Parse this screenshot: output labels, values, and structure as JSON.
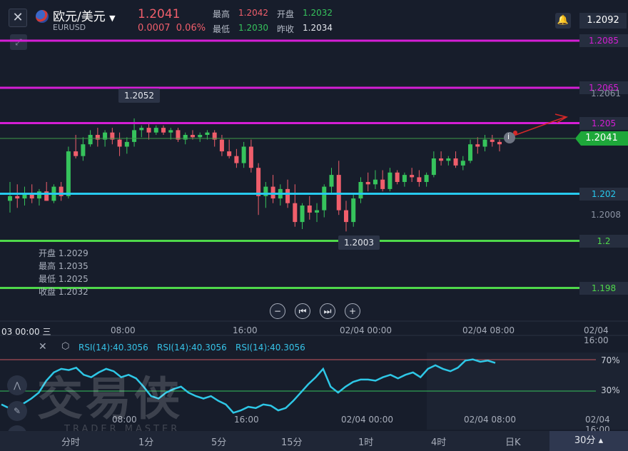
{
  "header": {
    "symbol_name": "欧元/美元",
    "symbol_code": "EURUSD",
    "price": "1.2041",
    "change": "0.0007",
    "change_pct": "0.06%",
    "high_label": "最高",
    "high_value": "1.2042",
    "open_label": "开盘",
    "open_value": "1.2032",
    "low_label": "最低",
    "low_value": "1.2030",
    "prev_close_label": "昨收",
    "prev_close_value": "1.2034",
    "top_right_price": "1.2092"
  },
  "price_lines": [
    {
      "label": "1.2085",
      "color": "#d51ed5"
    },
    {
      "label": "1.2065",
      "color": "#d51ed5"
    },
    {
      "label": "1.205",
      "color": "#d51ed5"
    },
    {
      "label": "1.202",
      "color": "#27c9ee"
    },
    {
      "label": "1.2",
      "color": "#4fd84a"
    },
    {
      "label": "1.198",
      "color": "#4fd84a"
    }
  ],
  "axis_prices": {
    "p1": "1.2061",
    "p2": "1.2008",
    "current": "1.2041"
  },
  "callouts": {
    "high": "1.2052",
    "low": "1.2003"
  },
  "ohlc_panel": {
    "open": "开盘 1.2029",
    "high": "最高 1.2035",
    "low": "最低 1.2025",
    "close": "收盘 1.2032"
  },
  "nav": [
    "−",
    "⏮",
    "⏭",
    "+"
  ],
  "time_axis": {
    "start": "03 00:00 三",
    "labels": [
      "08:00",
      "16:00",
      "02/04 00:00",
      "02/04 08:00",
      "02/04 16:00"
    ]
  },
  "rsi": {
    "labels": [
      "RSI(14):40.3056",
      "RSI(14):40.3056",
      "RSI(14):40.3056"
    ],
    "level_high": "70%",
    "level_low": "30%"
  },
  "rsi_time_axis": [
    "08:00",
    "16:00",
    "02/04 00:00",
    "02/04 08:00",
    "02/04 16:00"
  ],
  "periods": [
    "分时",
    "1分",
    "5分",
    "15分",
    "1时",
    "4时",
    "日K",
    "30分 ▴"
  ],
  "watermark": {
    "main": "交易侠",
    "sub": "TRADER MASTER"
  },
  "chart_data": {
    "type": "candlestick",
    "series": [
      {
        "name": "EURUSD 30分",
        "candles": [
          {
            "o": 1.2017,
            "h": 1.2025,
            "l": 1.2012,
            "c": 1.2019
          },
          {
            "o": 1.2019,
            "h": 1.2024,
            "l": 1.2014,
            "c": 1.2018
          },
          {
            "o": 1.2018,
            "h": 1.2023,
            "l": 1.2015,
            "c": 1.202
          },
          {
            "o": 1.202,
            "h": 1.2024,
            "l": 1.2016,
            "c": 1.2018
          },
          {
            "o": 1.2018,
            "h": 1.2022,
            "l": 1.2015,
            "c": 1.2021
          },
          {
            "o": 1.2021,
            "h": 1.2025,
            "l": 1.2017,
            "c": 1.2017
          },
          {
            "o": 1.2017,
            "h": 1.2024,
            "l": 1.2016,
            "c": 1.2023
          },
          {
            "o": 1.2023,
            "h": 1.2025,
            "l": 1.2017,
            "c": 1.2019
          },
          {
            "o": 1.2019,
            "h": 1.204,
            "l": 1.2018,
            "c": 1.2038
          },
          {
            "o": 1.2038,
            "h": 1.2045,
            "l": 1.2035,
            "c": 1.2036
          },
          {
            "o": 1.2036,
            "h": 1.2044,
            "l": 1.2034,
            "c": 1.2041
          },
          {
            "o": 1.2041,
            "h": 1.2047,
            "l": 1.204,
            "c": 1.2045
          },
          {
            "o": 1.2045,
            "h": 1.2048,
            "l": 1.204,
            "c": 1.2043
          },
          {
            "o": 1.2043,
            "h": 1.2047,
            "l": 1.204,
            "c": 1.2046
          },
          {
            "o": 1.2046,
            "h": 1.2048,
            "l": 1.2041,
            "c": 1.2043
          },
          {
            "o": 1.2043,
            "h": 1.2046,
            "l": 1.2036,
            "c": 1.204
          },
          {
            "o": 1.204,
            "h": 1.2044,
            "l": 1.2037,
            "c": 1.2042
          },
          {
            "o": 1.2042,
            "h": 1.2052,
            "l": 1.204,
            "c": 1.2047
          },
          {
            "o": 1.2047,
            "h": 1.2049,
            "l": 1.2044,
            "c": 1.2048
          },
          {
            "o": 1.2048,
            "h": 1.205,
            "l": 1.2043,
            "c": 1.2046
          },
          {
            "o": 1.2046,
            "h": 1.2049,
            "l": 1.2045,
            "c": 1.2048
          },
          {
            "o": 1.2048,
            "h": 1.2049,
            "l": 1.2045,
            "c": 1.2046
          },
          {
            "o": 1.2046,
            "h": 1.2048,
            "l": 1.2043,
            "c": 1.2047
          },
          {
            "o": 1.2047,
            "h": 1.2048,
            "l": 1.2042,
            "c": 1.2043
          },
          {
            "o": 1.2043,
            "h": 1.2046,
            "l": 1.2041,
            "c": 1.2045
          },
          {
            "o": 1.2045,
            "h": 1.2047,
            "l": 1.2043,
            "c": 1.2044
          },
          {
            "o": 1.2044,
            "h": 1.2046,
            "l": 1.2042,
            "c": 1.2045
          },
          {
            "o": 1.2045,
            "h": 1.2047,
            "l": 1.2043,
            "c": 1.2046
          },
          {
            "o": 1.2046,
            "h": 1.2047,
            "l": 1.204,
            "c": 1.2043
          },
          {
            "o": 1.2043,
            "h": 1.2045,
            "l": 1.2036,
            "c": 1.2038
          },
          {
            "o": 1.2038,
            "h": 1.2043,
            "l": 1.2035,
            "c": 1.2036
          },
          {
            "o": 1.2036,
            "h": 1.2039,
            "l": 1.2031,
            "c": 1.2033
          },
          {
            "o": 1.2033,
            "h": 1.2042,
            "l": 1.2031,
            "c": 1.204
          },
          {
            "o": 1.204,
            "h": 1.2043,
            "l": 1.2029,
            "c": 1.2031
          },
          {
            "o": 1.2031,
            "h": 1.2033,
            "l": 1.2011,
            "c": 1.2019
          },
          {
            "o": 1.2019,
            "h": 1.2025,
            "l": 1.2014,
            "c": 1.2023
          },
          {
            "o": 1.2023,
            "h": 1.2028,
            "l": 1.2016,
            "c": 1.2018
          },
          {
            "o": 1.2018,
            "h": 1.2024,
            "l": 1.2015,
            "c": 1.2022
          },
          {
            "o": 1.2022,
            "h": 1.2026,
            "l": 1.2014,
            "c": 1.2016
          },
          {
            "o": 1.2016,
            "h": 1.2024,
            "l": 1.2006,
            "c": 1.2008
          },
          {
            "o": 1.2008,
            "h": 1.2016,
            "l": 1.2005,
            "c": 1.2015
          },
          {
            "o": 1.2015,
            "h": 1.2019,
            "l": 1.2009,
            "c": 1.2012
          },
          {
            "o": 1.2012,
            "h": 1.2016,
            "l": 1.2008,
            "c": 1.2013
          },
          {
            "o": 1.2013,
            "h": 1.2024,
            "l": 1.201,
            "c": 1.2023
          },
          {
            "o": 1.2023,
            "h": 1.2031,
            "l": 1.202,
            "c": 1.2028
          },
          {
            "o": 1.2028,
            "h": 1.2034,
            "l": 1.2011,
            "c": 1.2013
          },
          {
            "o": 1.2013,
            "h": 1.2017,
            "l": 1.2004,
            "c": 1.2008
          },
          {
            "o": 1.2008,
            "h": 1.202,
            "l": 1.2006,
            "c": 1.2018
          },
          {
            "o": 1.2018,
            "h": 1.2027,
            "l": 1.2016,
            "c": 1.2025
          },
          {
            "o": 1.2025,
            "h": 1.2029,
            "l": 1.2021,
            "c": 1.2024
          },
          {
            "o": 1.2024,
            "h": 1.203,
            "l": 1.2022,
            "c": 1.2026
          },
          {
            "o": 1.2026,
            "h": 1.203,
            "l": 1.2021,
            "c": 1.2022
          },
          {
            "o": 1.2022,
            "h": 1.2031,
            "l": 1.2021,
            "c": 1.2029
          },
          {
            "o": 1.2029,
            "h": 1.203,
            "l": 1.2024,
            "c": 1.2025
          },
          {
            "o": 1.2025,
            "h": 1.2029,
            "l": 1.2023,
            "c": 1.2028
          },
          {
            "o": 1.2028,
            "h": 1.2031,
            "l": 1.2025,
            "c": 1.2027
          },
          {
            "o": 1.2027,
            "h": 1.203,
            "l": 1.2023,
            "c": 1.2025
          },
          {
            "o": 1.2025,
            "h": 1.2029,
            "l": 1.2023,
            "c": 1.2028
          },
          {
            "o": 1.2028,
            "h": 1.2038,
            "l": 1.2027,
            "c": 1.2035
          },
          {
            "o": 1.2035,
            "h": 1.2038,
            "l": 1.2032,
            "c": 1.2034
          },
          {
            "o": 1.2034,
            "h": 1.2036,
            "l": 1.2032,
            "c": 1.2035
          },
          {
            "o": 1.2035,
            "h": 1.2038,
            "l": 1.2031,
            "c": 1.2032
          },
          {
            "o": 1.2032,
            "h": 1.2036,
            "l": 1.203,
            "c": 1.2034
          },
          {
            "o": 1.2034,
            "h": 1.2043,
            "l": 1.2033,
            "c": 1.2041
          },
          {
            "o": 1.2041,
            "h": 1.2044,
            "l": 1.2037,
            "c": 1.204
          },
          {
            "o": 1.204,
            "h": 1.2045,
            "l": 1.2038,
            "c": 1.2043
          },
          {
            "o": 1.2043,
            "h": 1.2045,
            "l": 1.204,
            "c": 1.2042
          },
          {
            "o": 1.2042,
            "h": 1.2043,
            "l": 1.2038,
            "c": 1.2041
          }
        ]
      }
    ],
    "ylim": [
      1.1975,
      1.2095
    ],
    "rsi_values": [
      35,
      32,
      33,
      36,
      40,
      45,
      55,
      62,
      65,
      64,
      66,
      60,
      58,
      62,
      65,
      63,
      58,
      60,
      57,
      50,
      42,
      40,
      45,
      48,
      50,
      45,
      42,
      40,
      42,
      38,
      35,
      28,
      30,
      33,
      32,
      35,
      34,
      30,
      32,
      38,
      45,
      52,
      58,
      65,
      50,
      45,
      50,
      54,
      56,
      56,
      55,
      58,
      60,
      57,
      60,
      62,
      58,
      65,
      68,
      65,
      63,
      66,
      72,
      73,
      71,
      72,
      70
    ],
    "rsi_ylim": [
      15,
      80
    ],
    "rsi_levels": [
      70,
      30
    ]
  }
}
